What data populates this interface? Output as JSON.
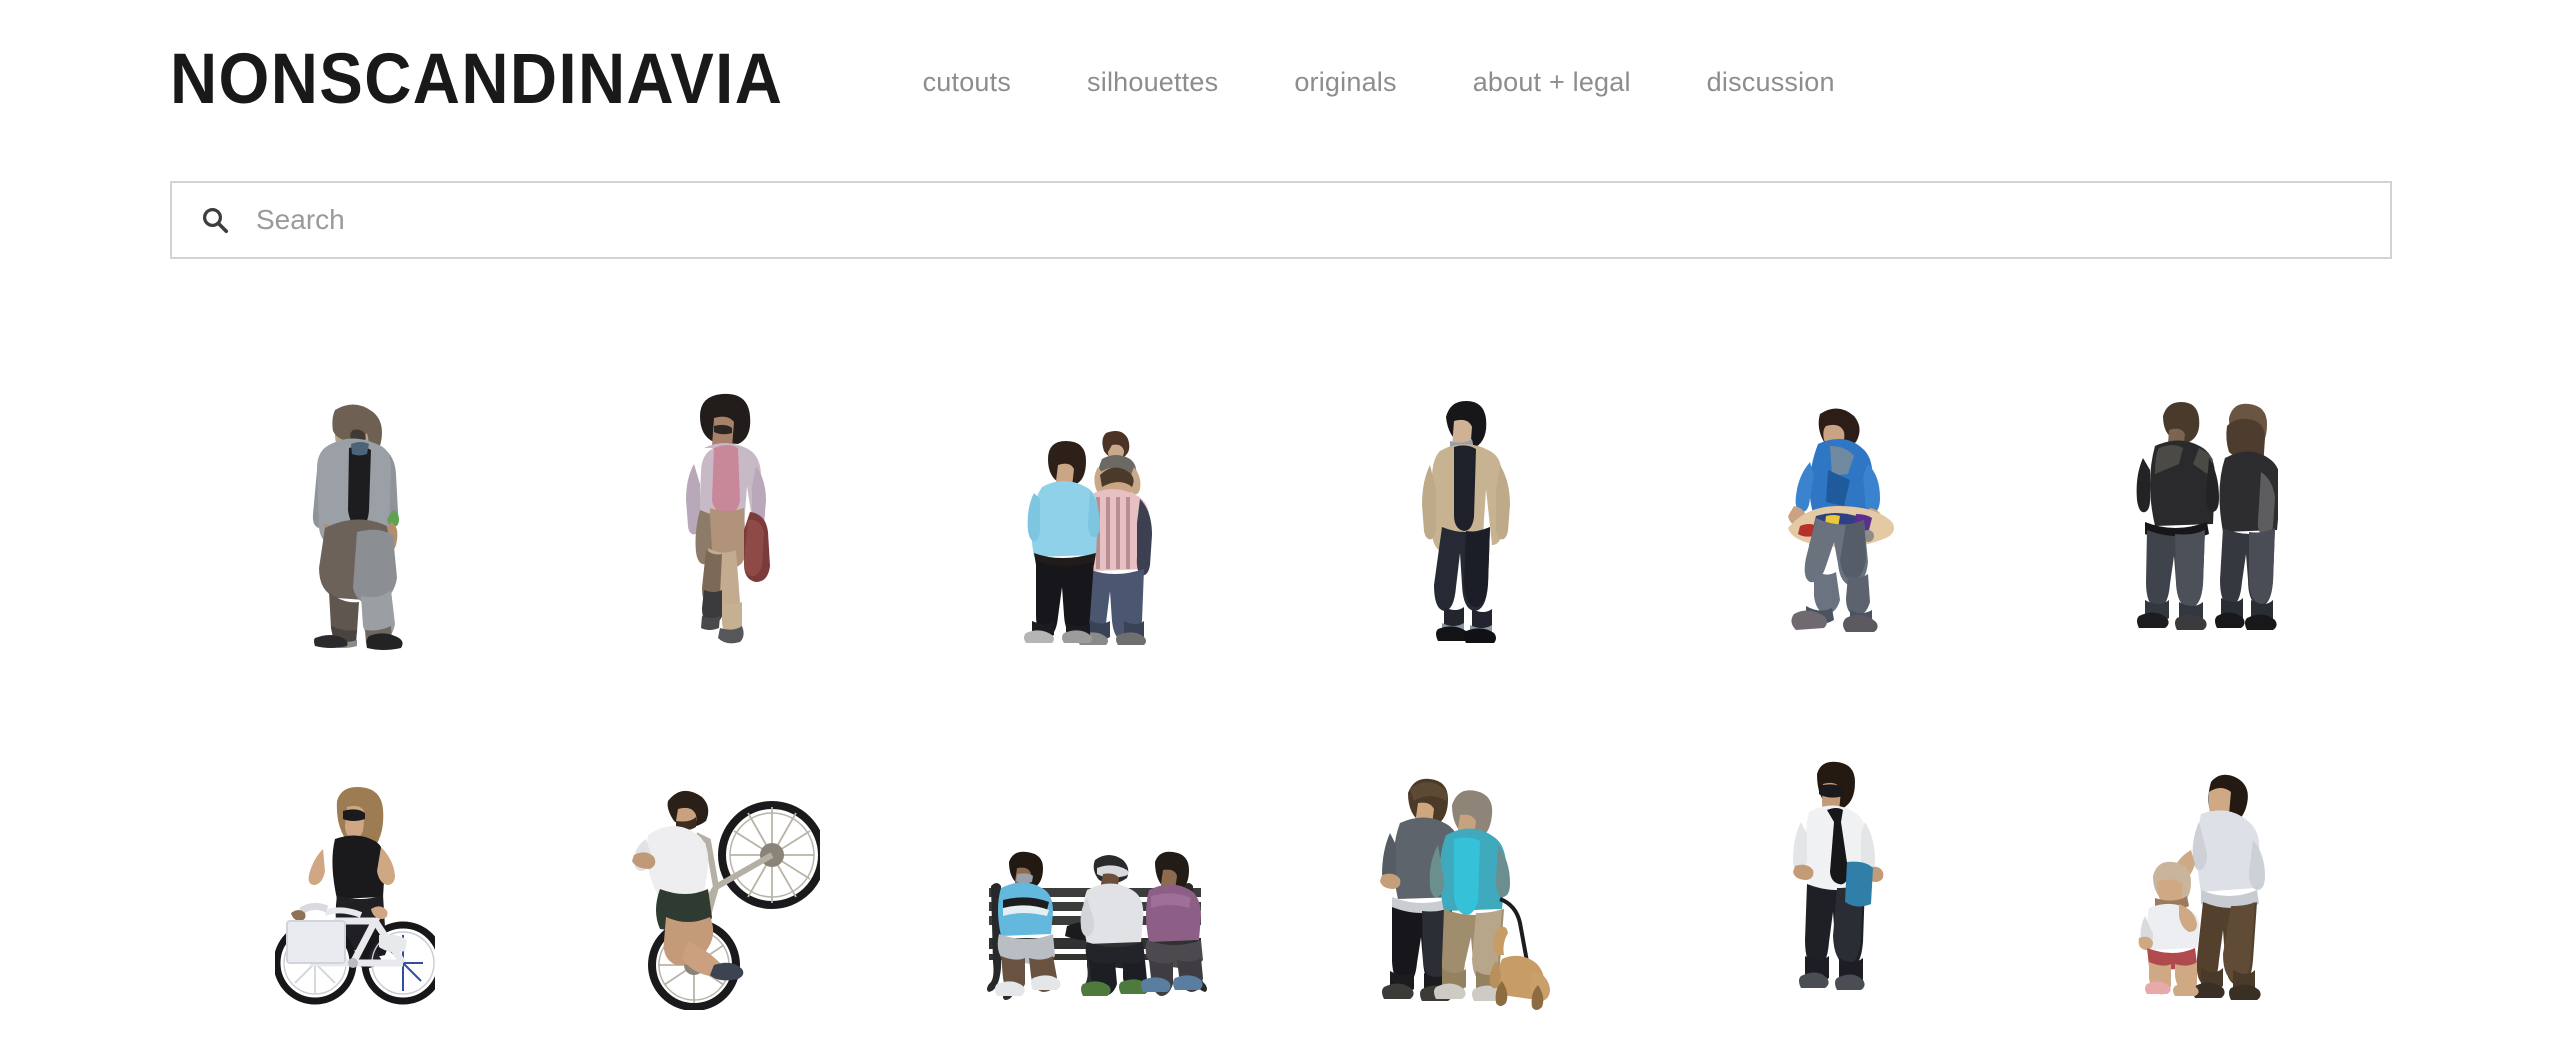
{
  "header": {
    "logo": "NONSCANDINAVIA",
    "nav": [
      {
        "label": "cutouts",
        "name": "nav-item-cutouts"
      },
      {
        "label": "silhouettes",
        "name": "nav-item-silhouettes"
      },
      {
        "label": "originals",
        "name": "nav-item-originals"
      },
      {
        "label": "about + legal",
        "name": "nav-item-about-legal"
      },
      {
        "label": "discussion",
        "name": "nav-item-discussion"
      }
    ]
  },
  "search": {
    "placeholder": "Search",
    "value": "",
    "icon": "search-icon"
  },
  "colors": {
    "background": "#ffffff",
    "logo_text": "#191919",
    "nav_text": "#8d8d8d",
    "search_border": "#d3d3d3",
    "placeholder_text": "#9a9a9a"
  },
  "gallery": {
    "columns": 6,
    "items": [
      {
        "name": "cutout-man-long-hair-grey-coat",
        "alt": "man with long hair in grey coat walking"
      },
      {
        "name": "cutout-woman-curly-hair-pink-coat",
        "alt": "woman with curly hair in pink coat carrying bag"
      },
      {
        "name": "cutout-family-child-on-shoulders",
        "alt": "family walking, child on father's shoulders"
      },
      {
        "name": "cutout-man-beige-jacket",
        "alt": "man in beige jacket and dark jeans walking"
      },
      {
        "name": "cutout-boy-with-skateboard",
        "alt": "boy in blue jacket carrying skateboard"
      },
      {
        "name": "cutout-couple-from-behind",
        "alt": "couple in dark clothing seen from behind"
      },
      {
        "name": "cutout-woman-on-bicycle",
        "alt": "woman in black dress riding white bicycle with basket"
      },
      {
        "name": "cutout-man-bike-wheelie",
        "alt": "man in white t-shirt doing a wheelie on a bicycle"
      },
      {
        "name": "cutout-three-people-on-bench",
        "alt": "three people sitting on a park bench"
      },
      {
        "name": "cutout-two-men-with-dog",
        "alt": "two men embracing while walking a dog on a leash"
      },
      {
        "name": "cutout-man-shirt-tie-folder",
        "alt": "man in white shirt and black tie carrying blue folder"
      },
      {
        "name": "cutout-woman-with-toddler",
        "alt": "woman holding a toddler's hand"
      }
    ]
  }
}
